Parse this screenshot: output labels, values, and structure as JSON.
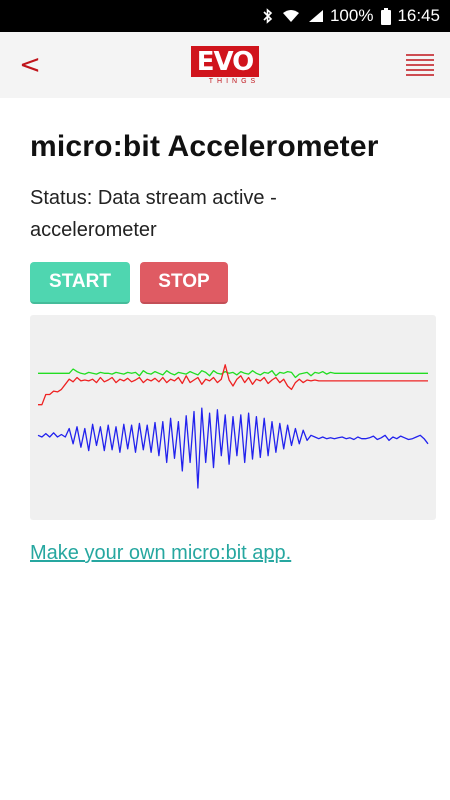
{
  "status_bar": {
    "battery": "100%",
    "time": "16:45",
    "icons": [
      "bluetooth-icon",
      "wifi-icon",
      "signal-icon",
      "battery-icon"
    ]
  },
  "app_bar": {
    "logo_mark": "EVO",
    "logo_sub": "THINGS",
    "back_icon": "chevron-left-icon",
    "menu_icon": "hamburger-menu-icon",
    "accent": "#c0141b"
  },
  "main": {
    "title": "micro:bit Accelerometer",
    "status_line1": "Status: Data stream active -",
    "status_line2": "accelerometer",
    "start_label": "START",
    "stop_label": "STOP",
    "link_text": "Make your own micro:bit app.",
    "colors": {
      "start": "#4fd6b0",
      "stop": "#df5b63",
      "link": "#26a7a0"
    }
  },
  "chart_data": {
    "type": "line",
    "grid": false,
    "legend": "none",
    "ylim": [
      -1,
      1
    ],
    "series": [
      {
        "color": "#22dd22",
        "values": [
          0.55,
          0.55,
          0.55,
          0.55,
          0.55,
          0.55,
          0.55,
          0.55,
          0.55,
          0.6,
          0.57,
          0.55,
          0.54,
          0.56,
          0.55,
          0.54,
          0.56,
          0.55,
          0.55,
          0.54,
          0.56,
          0.55,
          0.54,
          0.56,
          0.55,
          0.56,
          0.52,
          0.58,
          0.55,
          0.54,
          0.57,
          0.55,
          0.53,
          0.58,
          0.55,
          0.53,
          0.56,
          0.55,
          0.54,
          0.57,
          0.55,
          0.53,
          0.58,
          0.56,
          0.52,
          0.58,
          0.55,
          0.54,
          0.57,
          0.55,
          0.56,
          0.53,
          0.57,
          0.55,
          0.54,
          0.58,
          0.55,
          0.53,
          0.56,
          0.55,
          0.58,
          0.52,
          0.56,
          0.55,
          0.57,
          0.56,
          0.5,
          0.54,
          0.55,
          0.56,
          0.52,
          0.56,
          0.55,
          0.57,
          0.54,
          0.56,
          0.55,
          0.55,
          0.55,
          0.55,
          0.55,
          0.55,
          0.55,
          0.55,
          0.55,
          0.55,
          0.55,
          0.55,
          0.55,
          0.55,
          0.55,
          0.55,
          0.55,
          0.55,
          0.55,
          0.55,
          0.55,
          0.55,
          0.55,
          0.55,
          0.55
        ]
      },
      {
        "color": "#ee2222",
        "values": [
          0.18,
          0.18,
          0.3,
          0.3,
          0.34,
          0.33,
          0.36,
          0.42,
          0.48,
          0.45,
          0.5,
          0.46,
          0.47,
          0.46,
          0.48,
          0.44,
          0.5,
          0.45,
          0.47,
          0.5,
          0.44,
          0.48,
          0.46,
          0.49,
          0.45,
          0.47,
          0.5,
          0.44,
          0.48,
          0.46,
          0.49,
          0.45,
          0.5,
          0.44,
          0.48,
          0.46,
          0.5,
          0.43,
          0.52,
          0.44,
          0.47,
          0.5,
          0.42,
          0.48,
          0.46,
          0.5,
          0.44,
          0.48,
          0.65,
          0.47,
          0.4,
          0.48,
          0.52,
          0.44,
          0.5,
          0.42,
          0.48,
          0.46,
          0.5,
          0.43,
          0.47,
          0.5,
          0.44,
          0.48,
          0.4,
          0.36,
          0.44,
          0.48,
          0.44,
          0.47,
          0.46,
          0.47,
          0.46,
          0.46,
          0.46,
          0.46,
          0.46,
          0.46,
          0.46,
          0.46,
          0.46,
          0.46,
          0.46,
          0.46,
          0.46,
          0.46,
          0.46,
          0.46,
          0.46,
          0.46,
          0.46,
          0.46,
          0.46,
          0.46,
          0.46,
          0.46,
          0.46,
          0.46,
          0.46,
          0.46,
          0.46
        ]
      },
      {
        "color": "#2222ee",
        "values": [
          -0.18,
          -0.2,
          -0.16,
          -0.2,
          -0.15,
          -0.2,
          -0.17,
          -0.2,
          -0.1,
          -0.28,
          -0.08,
          -0.32,
          -0.1,
          -0.36,
          -0.05,
          -0.3,
          -0.08,
          -0.36,
          -0.06,
          -0.35,
          -0.08,
          -0.38,
          -0.05,
          -0.34,
          -0.06,
          -0.38,
          -0.04,
          -0.35,
          -0.06,
          -0.38,
          -0.03,
          -0.42,
          -0.02,
          -0.5,
          0.02,
          -0.45,
          -0.02,
          -0.6,
          0.05,
          -0.5,
          0.1,
          -0.8,
          0.14,
          -0.5,
          0.08,
          -0.56,
          0.12,
          -0.42,
          0.06,
          -0.52,
          0.04,
          -0.42,
          0.06,
          -0.5,
          0.08,
          -0.46,
          0.04,
          -0.44,
          0.02,
          -0.42,
          -0.02,
          -0.38,
          -0.04,
          -0.34,
          -0.06,
          -0.3,
          -0.1,
          -0.28,
          -0.12,
          -0.24,
          -0.18,
          -0.2,
          -0.22,
          -0.2,
          -0.22,
          -0.21,
          -0.22,
          -0.21,
          -0.2,
          -0.22,
          -0.21,
          -0.23,
          -0.2,
          -0.22,
          -0.22,
          -0.21,
          -0.19,
          -0.23,
          -0.21,
          -0.18,
          -0.24,
          -0.2,
          -0.22,
          -0.19,
          -0.21,
          -0.23,
          -0.22,
          -0.2,
          -0.18,
          -0.22,
          -0.28
        ]
      }
    ]
  }
}
